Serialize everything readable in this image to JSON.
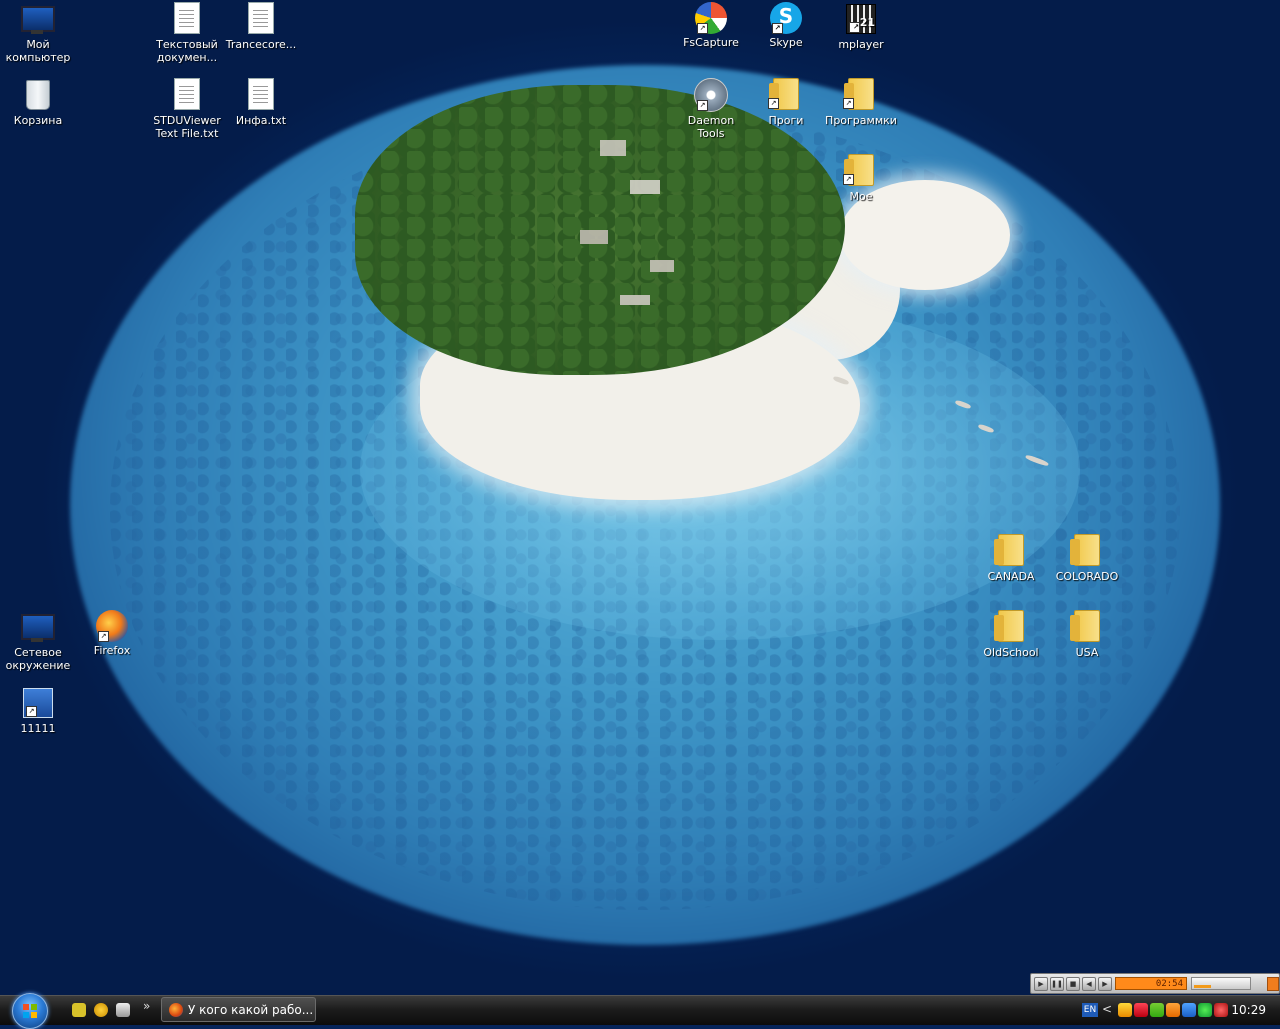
{
  "desktop": {
    "icons": [
      {
        "id": "my-computer",
        "label": "Мой\nкомпьютер",
        "icon": "monitor-icon"
      },
      {
        "id": "recycle-bin",
        "label": "Корзина",
        "icon": "recycle-bin-icon"
      },
      {
        "id": "text-doc",
        "label": "Текстовый\nдокумен...",
        "icon": "text-document-icon"
      },
      {
        "id": "trancecore",
        "label": "Trancecore...",
        "icon": "text-document-icon"
      },
      {
        "id": "stduviewer",
        "label": "STDUViewer\nText File.txt",
        "icon": "text-document-icon"
      },
      {
        "id": "infa",
        "label": "Инфа.txt",
        "icon": "text-document-icon"
      },
      {
        "id": "fscapture",
        "label": "FsCapture",
        "icon": "fscapture-icon"
      },
      {
        "id": "skype",
        "label": "Skype",
        "icon": "skype-icon"
      },
      {
        "id": "mplayer",
        "label": "mplayer",
        "icon": "mplayer-icon"
      },
      {
        "id": "daemon",
        "label": "Daemon Tools",
        "icon": "daemon-tools-icon"
      },
      {
        "id": "progi",
        "label": "Проги",
        "icon": "folder-icon"
      },
      {
        "id": "programmki",
        "label": "Программки",
        "icon": "folder-icon"
      },
      {
        "id": "moe",
        "label": "Мое",
        "icon": "folder-icon"
      },
      {
        "id": "network",
        "label": "Сетевое\nокружение",
        "icon": "network-icon"
      },
      {
        "id": "firefox",
        "label": "Firefox",
        "icon": "firefox-icon"
      },
      {
        "id": "n11111",
        "label": "11111",
        "icon": "remote-desktop-icon"
      },
      {
        "id": "canada",
        "label": "CANADA",
        "icon": "folder-icon"
      },
      {
        "id": "colorado",
        "label": "COLORADO",
        "icon": "folder-icon"
      },
      {
        "id": "oldschool",
        "label": "OldSchool",
        "icon": "folder-icon"
      },
      {
        "id": "usa",
        "label": "USA",
        "icon": "folder-icon"
      }
    ]
  },
  "taskbar": {
    "quick_launch_more": "»",
    "task_button_label": "У кого какой рабо...",
    "tray": {
      "language": "EN",
      "arrow": "<",
      "clock": "10:29"
    }
  },
  "media_player": {
    "time": "02:54",
    "volume_level": 0.3
  },
  "colors": {
    "ocean": "#06245a",
    "lagoon": "#5fb7dd",
    "taskbar": "#1d1d1d",
    "media_time_bg": "#ff8a1a"
  }
}
